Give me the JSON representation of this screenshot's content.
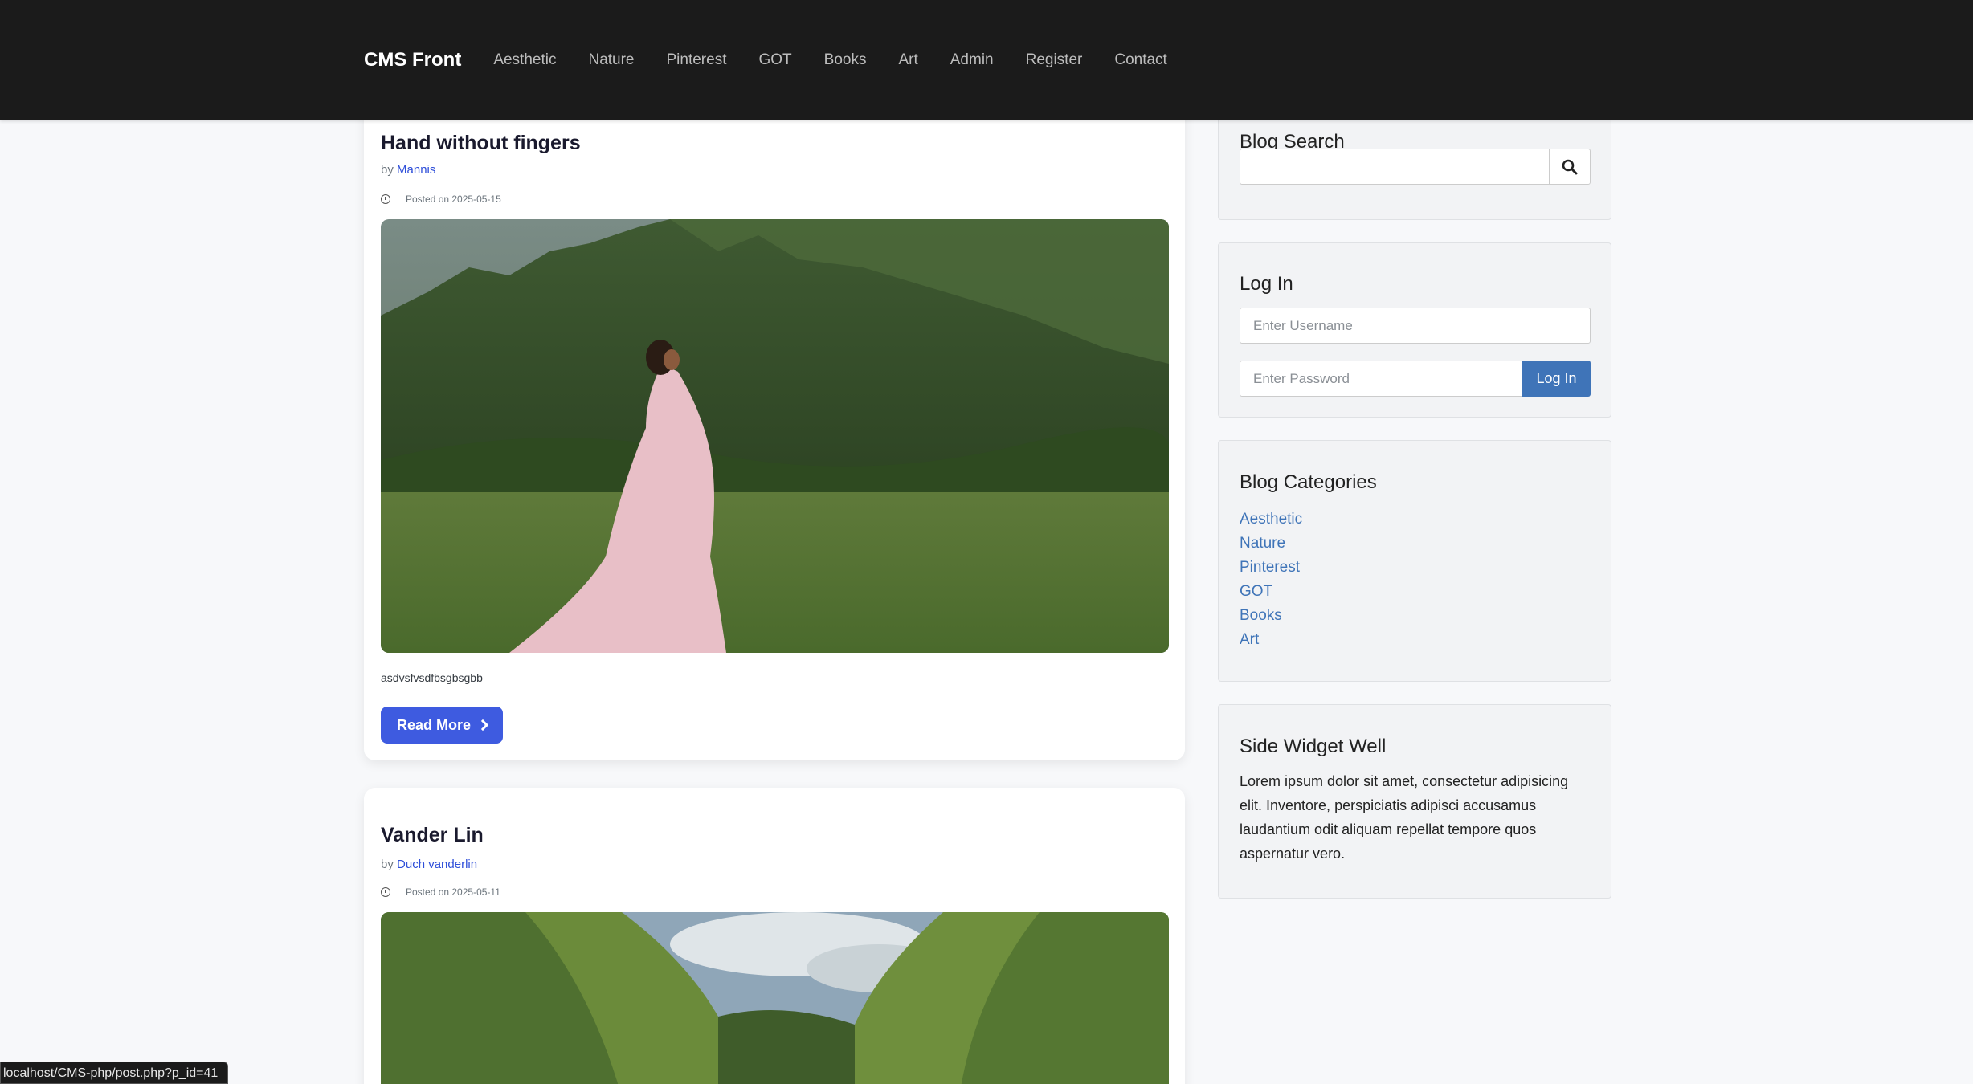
{
  "navbar": {
    "brand": "CMS Front",
    "links": [
      "Aesthetic",
      "Nature",
      "Pinterest",
      "GOT",
      "Books",
      "Art",
      "Admin",
      "Register",
      "Contact"
    ]
  },
  "posts": [
    {
      "title": "Hand without fingers",
      "by_prefix": "by",
      "author": "Mannis",
      "date": "Posted on 2025-05-15",
      "excerpt": "asdvsfvsdfbsgbsgbb",
      "read_more": "Read More"
    },
    {
      "title": "Vander Lin",
      "by_prefix": "by",
      "author": "Duch vanderlin",
      "date": "Posted on 2025-05-11"
    }
  ],
  "sidebar": {
    "search": {
      "title": "Blog Search",
      "placeholder": ""
    },
    "login": {
      "title": "Log In",
      "username_placeholder": "Enter Username",
      "password_placeholder": "Enter Password",
      "button": "Log In"
    },
    "categories": {
      "title": "Blog Categories",
      "items": [
        "Aesthetic",
        "Nature",
        "Pinterest",
        "GOT",
        "Books",
        "Art"
      ]
    },
    "widget_well": {
      "title": "Side Widget Well",
      "text": "Lorem ipsum dolor sit amet, consectetur adipisicing elit. Inventore, perspiciatis adipisci accusamus laudantium odit aliquam repellat tempore quos aspernatur vero."
    }
  },
  "status_bar": {
    "url": "localhost/CMS-php/post.php?p_id=41"
  },
  "icons": {
    "search": "search-icon",
    "clock": "clock-icon",
    "chevron": "chevron-right-icon"
  },
  "colors": {
    "navbar": "#1b1b1b",
    "accent": "#3e5be0",
    "link": "#3f74b8"
  }
}
